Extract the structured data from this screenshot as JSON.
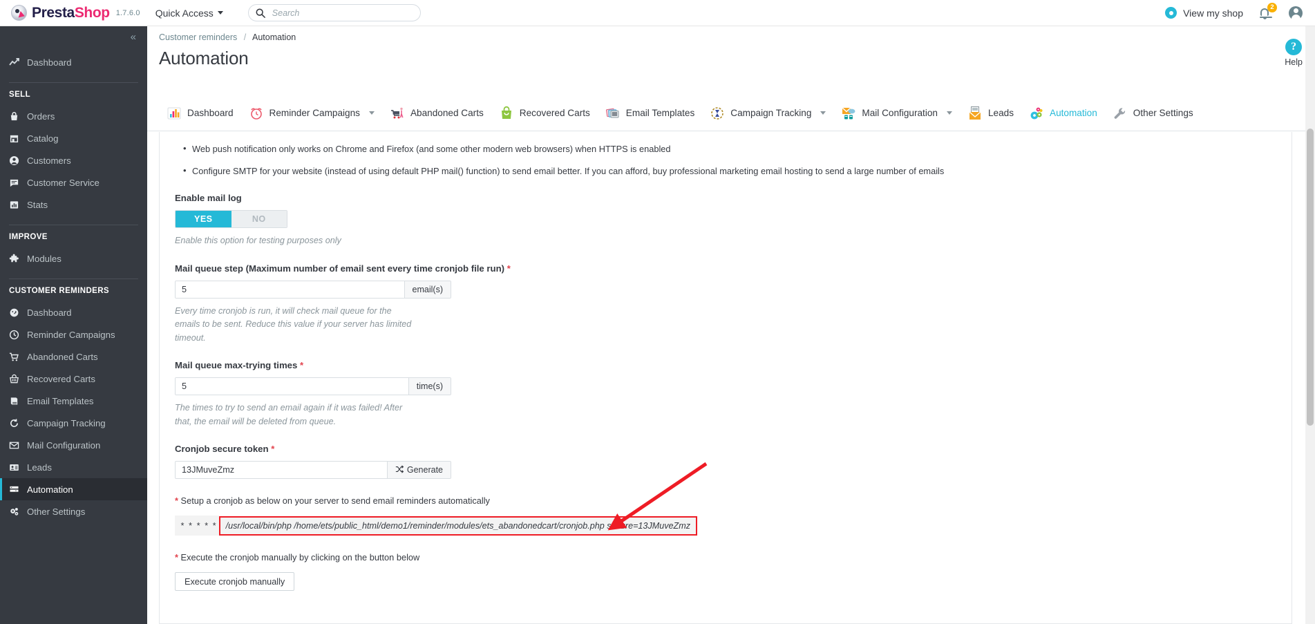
{
  "header": {
    "brand_presta": "Presta",
    "brand_shop": "Shop",
    "version": "1.7.6.0",
    "quick_access": "Quick Access",
    "search_placeholder": "Search",
    "search_value": "",
    "view_shop": "View my shop",
    "notification_count": "2",
    "icons": {
      "search": "search-icon",
      "eye": "eye-icon",
      "bell": "bell-icon",
      "avatar": "avatar-icon"
    }
  },
  "sidebar": {
    "collapse": "«",
    "dashboard": {
      "label": "Dashboard",
      "icon": "trending-up-icon"
    },
    "groups": [
      {
        "heading": "SELL",
        "items": [
          {
            "label": "Orders",
            "icon": "basket-icon",
            "active": false
          },
          {
            "label": "Catalog",
            "icon": "store-icon",
            "active": false
          },
          {
            "label": "Customers",
            "icon": "person-icon",
            "active": false
          },
          {
            "label": "Customer Service",
            "icon": "chat-icon",
            "active": false
          },
          {
            "label": "Stats",
            "icon": "bar-chart-icon",
            "active": false
          }
        ]
      },
      {
        "heading": "IMPROVE",
        "items": [
          {
            "label": "Modules",
            "icon": "puzzle-icon",
            "active": false
          }
        ]
      },
      {
        "heading": "CUSTOMER REMINDERS",
        "items": [
          {
            "label": "Dashboard",
            "icon": "gauge-icon",
            "active": false
          },
          {
            "label": "Reminder Campaigns",
            "icon": "clock-icon",
            "active": false
          },
          {
            "label": "Abandoned Carts",
            "icon": "cart-icon",
            "active": false
          },
          {
            "label": "Recovered Carts",
            "icon": "basket-icon",
            "active": false
          },
          {
            "label": "Email Templates",
            "icon": "book-icon",
            "active": false
          },
          {
            "label": "Campaign Tracking",
            "icon": "refresh-icon",
            "active": false
          },
          {
            "label": "Mail Configuration",
            "icon": "envelope-icon",
            "active": false
          },
          {
            "label": "Leads",
            "icon": "id-card-icon",
            "active": false
          },
          {
            "label": "Automation",
            "icon": "sliders-icon",
            "active": true
          },
          {
            "label": "Other Settings",
            "icon": "cogs-icon",
            "active": false
          }
        ]
      }
    ]
  },
  "breadcrumb": {
    "parent": "Customer reminders",
    "separator": "/",
    "current": "Automation"
  },
  "page": {
    "title": "Automation",
    "help_label": "Help",
    "help_glyph": "?"
  },
  "tabs": [
    {
      "label": "Dashboard",
      "icon": "bar-chart-color-icon",
      "active": false,
      "caret": false
    },
    {
      "label": "Reminder Campaigns",
      "icon": "alarm-clock-icon",
      "active": false,
      "caret": true
    },
    {
      "label": "Abandoned Carts",
      "icon": "shopping-cart-woman-icon",
      "active": false,
      "caret": false
    },
    {
      "label": "Recovered Carts",
      "icon": "green-bag-icon",
      "active": false,
      "caret": false
    },
    {
      "label": "Email Templates",
      "icon": "email-templates-icon",
      "active": false,
      "caret": false
    },
    {
      "label": "Campaign Tracking",
      "icon": "tracking-icon",
      "active": false,
      "caret": true
    },
    {
      "label": "Mail Configuration",
      "icon": "mail-config-icon",
      "active": false,
      "caret": true
    },
    {
      "label": "Leads",
      "icon": "leads-icon",
      "active": false,
      "caret": false
    },
    {
      "label": "Automation",
      "icon": "gears-icon",
      "active": true,
      "caret": false
    },
    {
      "label": "Other Settings",
      "icon": "wrench-icon",
      "active": false,
      "caret": false
    }
  ],
  "content": {
    "bullets": [
      "Web push notification only works on Chrome and Firefox (and some other modern web browsers) when HTTPS is enabled",
      "Configure SMTP for your website (instead of using default PHP mail() function) to send email better. If you can afford, buy professional marketing email hosting to send a large number of emails"
    ],
    "mail_log": {
      "label": "Enable mail log",
      "yes": "YES",
      "no": "NO",
      "selected": "YES",
      "hint": "Enable this option for testing purposes only"
    },
    "queue_step": {
      "label": "Mail queue step (Maximum number of email sent every time cronjob file run)",
      "required": "*",
      "value": "5",
      "unit": "email(s)",
      "hint": "Every time cronjob is run, it will check mail queue for the emails to be sent. Reduce this value if your server has limited timeout."
    },
    "max_trying": {
      "label": "Mail queue max-trying times",
      "required": "*",
      "value": "5",
      "unit": "time(s)",
      "hint": "The times to try to send an email again if it was failed! After that, the email will be deleted from queue."
    },
    "secure_token": {
      "label": "Cronjob secure token",
      "required": "*",
      "value": "13JMuveZmz",
      "generate_label": "Generate",
      "generate_icon": "shuffle-icon"
    },
    "cron_note": {
      "star": "*",
      "text": "Setup a cronjob as below on your server to send email reminders automatically"
    },
    "cron_command": {
      "schedule": "* * * * *",
      "command": "/usr/local/bin/php /home/ets/public_html/demo1/reminder/modules/ets_abandonedcart/cronjob.php secure=13JMuveZmz",
      "highlight_color": "#ee1c25"
    },
    "exec_note": {
      "star": "*",
      "text": "Execute the cronjob manually by clicking on the button below"
    },
    "exec_button": "Execute cronjob manually"
  },
  "colors": {
    "accent": "#25b9d7",
    "brand_pink": "#ec2b72",
    "brand_navy": "#231f49",
    "sidebar_bg": "#363a41",
    "required_red": "#e2444e",
    "annotation_red": "#ee1c25",
    "badge_orange": "#fab000"
  }
}
